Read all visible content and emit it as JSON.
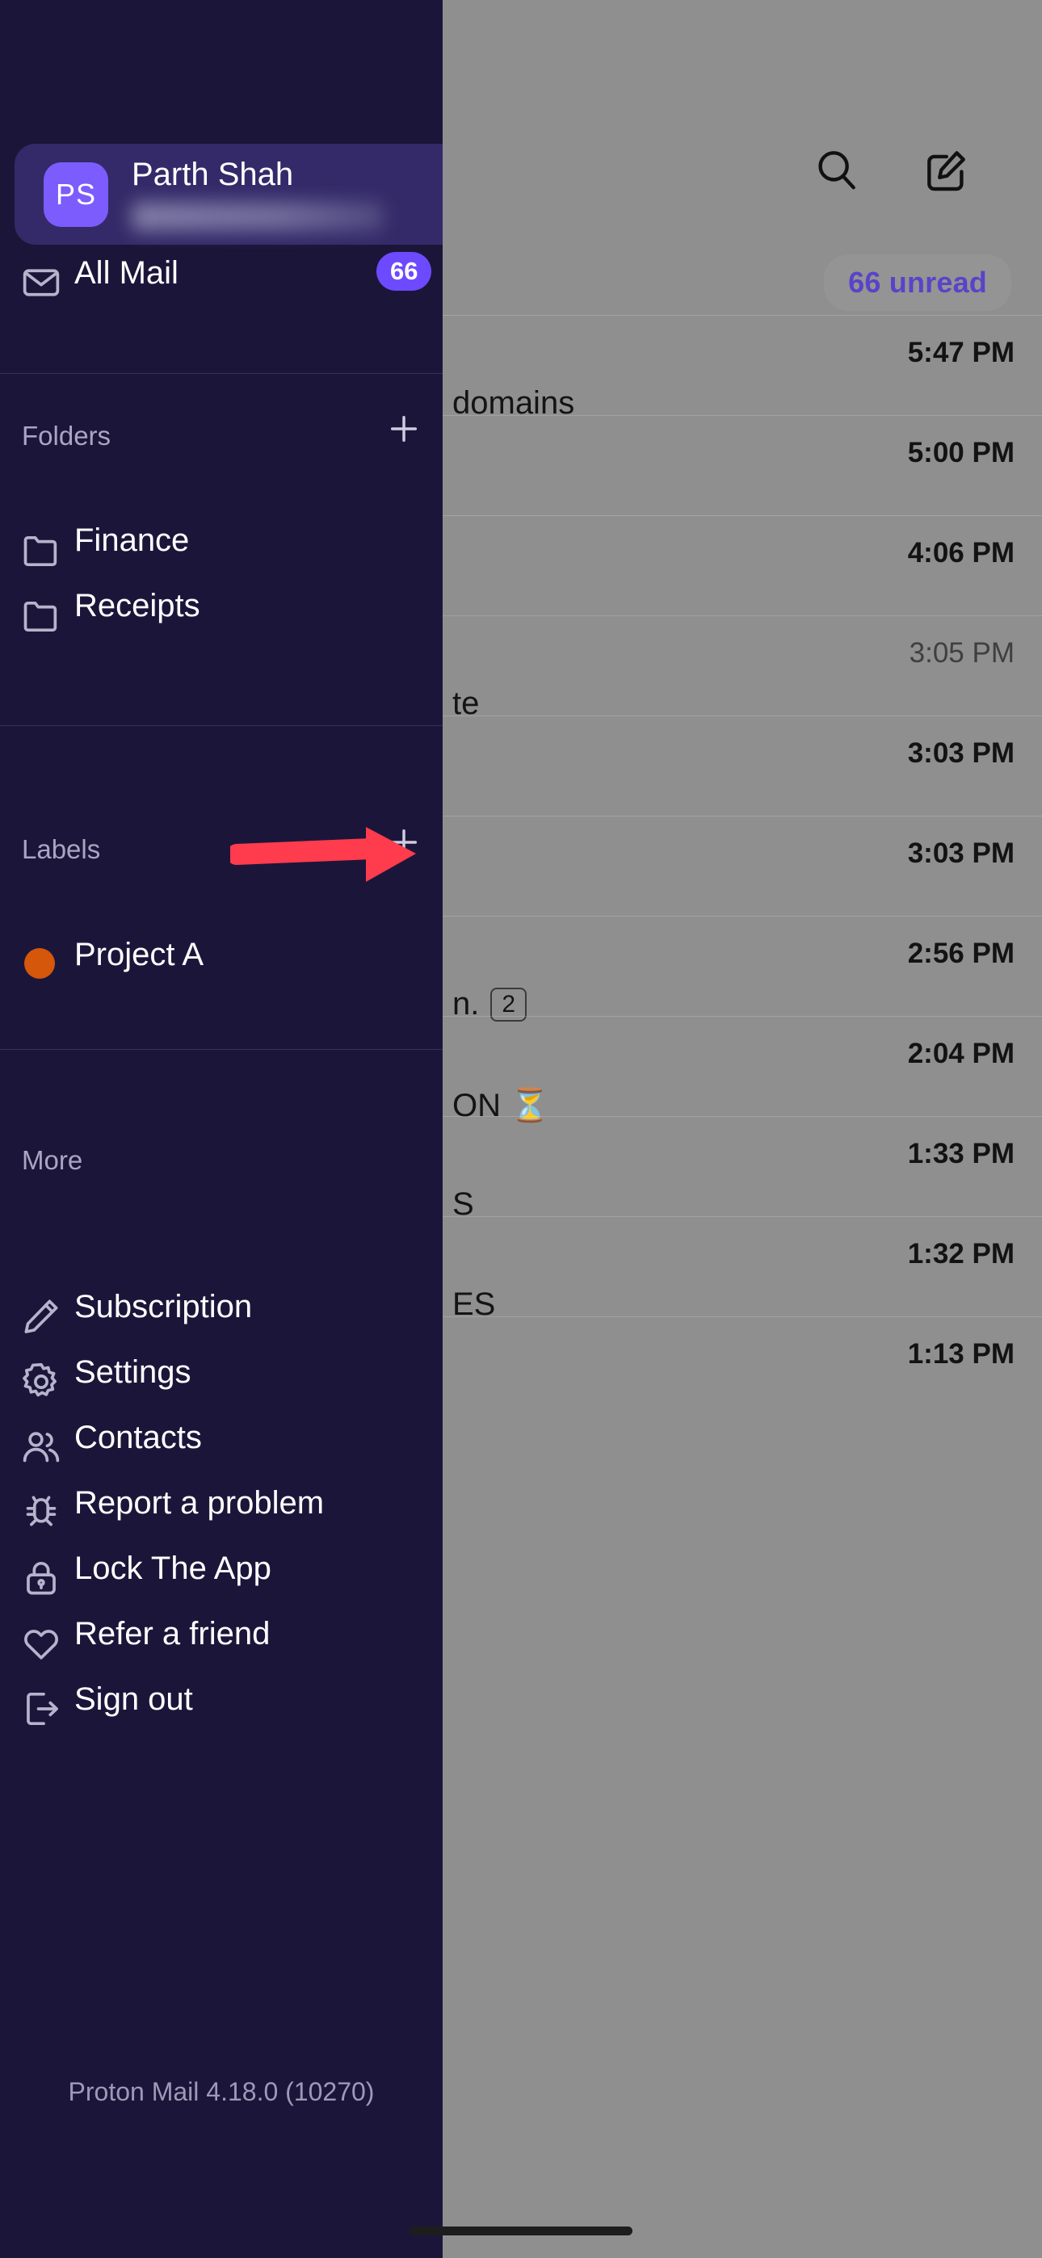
{
  "app": {
    "version_text": "Proton Mail 4.18.0 (10270)",
    "accent_color": "#6D4AFF",
    "drawer_bg": "#1B1639",
    "card_bg": "#342A69",
    "annotation_arrow_color": "#FF3B4E"
  },
  "account": {
    "initials": "PS",
    "name": "Parth Shah",
    "email_redacted": true,
    "expand_icon": "chevron-down-icon"
  },
  "all_mail": {
    "icon": "envelope-icon",
    "label": "All Mail",
    "badge": "66"
  },
  "folders_section": {
    "title": "Folders",
    "add_icon": "plus-icon",
    "items": [
      {
        "label": "Finance",
        "icon": "folder-icon"
      },
      {
        "label": "Receipts",
        "icon": "folder-icon"
      }
    ]
  },
  "labels_section": {
    "title": "Labels",
    "add_icon": "plus-icon",
    "items": [
      {
        "label": "Project A",
        "icon": "circle-dot-icon",
        "color": "#D4570C"
      }
    ]
  },
  "more_section": {
    "title": "More",
    "items": [
      {
        "label": "Subscription",
        "icon": "pencil-icon"
      },
      {
        "label": "Settings",
        "icon": "gear-icon"
      },
      {
        "label": "Contacts",
        "icon": "people-icon"
      },
      {
        "label": "Report a problem",
        "icon": "bug-icon"
      },
      {
        "label": "Lock The App",
        "icon": "lock-icon"
      },
      {
        "label": "Refer a friend",
        "icon": "heart-icon"
      },
      {
        "label": "Sign out",
        "icon": "sign-out-icon"
      }
    ]
  },
  "mail_list": {
    "search_icon": "search-icon",
    "compose_icon": "compose-icon",
    "unread_pill": "66 unread",
    "rows": [
      {
        "time": "5:47 PM",
        "snippet": "domains",
        "read": false,
        "count": ""
      },
      {
        "time": "5:00 PM",
        "snippet": "",
        "read": false,
        "count": ""
      },
      {
        "time": "4:06 PM",
        "snippet": "",
        "read": false,
        "count": ""
      },
      {
        "time": "3:05 PM",
        "snippet": "te",
        "read": true,
        "count": ""
      },
      {
        "time": "3:03 PM",
        "snippet": "",
        "read": false,
        "count": ""
      },
      {
        "time": "3:03 PM",
        "snippet": "",
        "read": false,
        "count": ""
      },
      {
        "time": "2:56 PM",
        "snippet": "n.",
        "read": false,
        "count": "2"
      },
      {
        "time": "2:04 PM",
        "snippet": "ON ⏳",
        "read": false,
        "count": ""
      },
      {
        "time": "1:33 PM",
        "snippet": "S",
        "read": false,
        "count": ""
      },
      {
        "time": "1:32 PM",
        "snippet": "ES",
        "read": false,
        "count": ""
      },
      {
        "time": "1:13 PM",
        "snippet": "",
        "read": false,
        "count": ""
      }
    ]
  }
}
